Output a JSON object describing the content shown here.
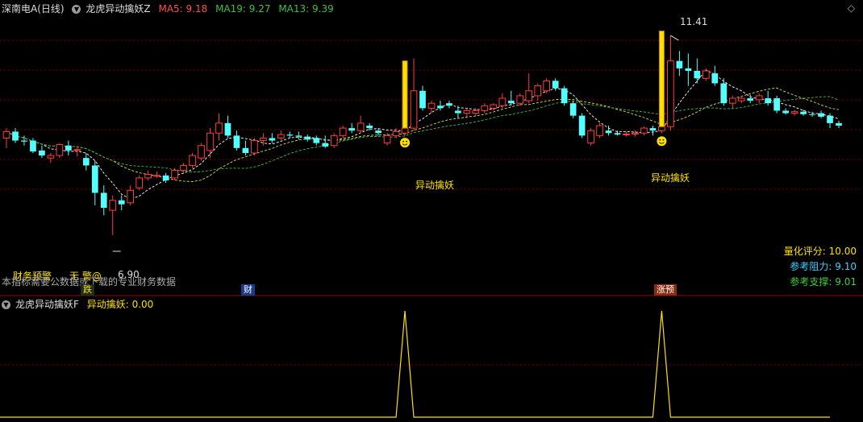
{
  "header": {
    "stock_name": "深南电A(日线)",
    "indicator_name": "龙虎异动擒妖Z",
    "ma5_label": "MA5: 9.18",
    "ma19_label": "MA19: 9.27",
    "ma13_label": "MA13: 9.39"
  },
  "sub_header": {
    "indicator_name": "龙虎异动擒妖F",
    "value_label": "异动擒妖: 0.00"
  },
  "annotations": {
    "high_label": "11.41",
    "low_label": "6.90",
    "signal_label": "异动擒妖",
    "finance_warning": "财务预警",
    "finance_note": "本指标需要公数据或下载的专业财务数据",
    "no_warning": "无 警@",
    "marker_die": "跌",
    "marker_cai": "财",
    "marker_zhang": "涨预"
  },
  "stats": {
    "score_label": "量化评分: 10.00",
    "resist_label": "参考阻力: 9.10",
    "support_label": "参考支撑: 9.01"
  },
  "colors": {
    "up": "#ff3c3c",
    "down": "#54ffff",
    "ma5": "#ffffff",
    "ma13": "#e0e040",
    "ma19": "#40c040",
    "signal": "#ffe000",
    "grid": "#7a0000"
  },
  "chart_data": {
    "type": "candlestick",
    "ylim": [
      6.3,
      11.8
    ],
    "candles": [
      [
        9.35,
        9.55,
        9.15,
        9.48
      ],
      [
        9.48,
        9.55,
        9.25,
        9.3
      ],
      [
        9.3,
        9.4,
        9.2,
        9.28
      ],
      [
        9.3,
        9.35,
        9.05,
        9.08
      ],
      [
        9.1,
        9.2,
        8.95,
        9.0
      ],
      [
        8.95,
        9.05,
        8.85,
        9.0
      ],
      [
        9.0,
        9.25,
        8.95,
        9.22
      ],
      [
        9.2,
        9.3,
        9.0,
        9.1
      ],
      [
        9.1,
        9.18,
        8.98,
        9.12
      ],
      [
        8.95,
        9.05,
        8.7,
        8.8
      ],
      [
        8.8,
        8.9,
        8.0,
        8.25
      ],
      [
        8.25,
        8.4,
        7.8,
        7.95
      ],
      [
        7.9,
        8.2,
        7.4,
        8.1
      ],
      [
        8.1,
        8.2,
        7.9,
        8.02
      ],
      [
        8.05,
        8.4,
        8.0,
        8.3
      ],
      [
        8.35,
        8.6,
        8.3,
        8.55
      ],
      [
        8.55,
        8.7,
        8.5,
        8.62
      ],
      [
        8.6,
        8.68,
        8.55,
        8.6
      ],
      [
        8.6,
        8.65,
        8.45,
        8.5
      ],
      [
        8.55,
        8.75,
        8.5,
        8.7
      ],
      [
        8.7,
        8.85,
        8.65,
        8.8
      ],
      [
        8.8,
        9.05,
        8.75,
        9.0
      ],
      [
        8.95,
        9.25,
        8.9,
        9.2
      ],
      [
        9.1,
        9.55,
        8.95,
        9.45
      ],
      [
        9.45,
        9.85,
        9.3,
        9.65
      ],
      [
        9.65,
        9.8,
        9.35,
        9.4
      ],
      [
        9.4,
        9.5,
        9.1,
        9.15
      ],
      [
        9.15,
        9.3,
        9.0,
        9.05
      ],
      [
        9.05,
        9.35,
        9.0,
        9.3
      ],
      [
        9.3,
        9.45,
        9.2,
        9.35
      ],
      [
        9.35,
        9.45,
        9.25,
        9.3
      ],
      [
        9.35,
        9.5,
        9.3,
        9.42
      ],
      [
        9.42,
        9.48,
        9.35,
        9.4
      ],
      [
        9.4,
        9.48,
        9.32,
        9.38
      ],
      [
        9.38,
        9.42,
        9.28,
        9.32
      ],
      [
        9.35,
        9.4,
        9.2,
        9.25
      ],
      [
        9.25,
        9.4,
        9.15,
        9.18
      ],
      [
        9.2,
        9.45,
        9.15,
        9.4
      ],
      [
        9.4,
        9.6,
        9.35,
        9.55
      ],
      [
        9.55,
        9.65,
        9.45,
        9.5
      ],
      [
        9.5,
        9.8,
        9.45,
        9.65
      ],
      [
        9.6,
        9.65,
        9.5,
        9.55
      ],
      [
        9.5,
        9.55,
        9.4,
        9.45
      ],
      [
        9.25,
        9.45,
        9.2,
        9.4
      ],
      [
        9.4,
        9.55,
        9.35,
        9.48
      ],
      [
        9.45,
        9.6,
        9.4,
        9.55
      ],
      [
        9.55,
        10.95,
        9.5,
        10.3
      ],
      [
        10.3,
        10.4,
        9.9,
        9.95
      ],
      [
        9.95,
        10.1,
        9.85,
        10.05
      ],
      [
        10.0,
        10.1,
        9.9,
        9.95
      ],
      [
        10.05,
        10.1,
        9.95,
        10.0
      ],
      [
        9.9,
        10.0,
        9.75,
        9.85
      ],
      [
        9.85,
        9.95,
        9.75,
        9.9
      ],
      [
        9.85,
        9.95,
        9.8,
        9.9
      ],
      [
        9.9,
        10.05,
        9.85,
        10.0
      ],
      [
        9.95,
        10.05,
        9.9,
        10.02
      ],
      [
        10.0,
        10.25,
        9.95,
        10.15
      ],
      [
        10.1,
        10.3,
        10.0,
        10.05
      ],
      [
        10.05,
        10.25,
        10.0,
        10.2
      ],
      [
        10.1,
        10.65,
        10.05,
        10.3
      ],
      [
        10.2,
        10.45,
        10.1,
        10.4
      ],
      [
        10.3,
        10.55,
        10.25,
        10.5
      ],
      [
        10.5,
        10.55,
        10.3,
        10.35
      ],
      [
        10.35,
        10.4,
        10.0,
        10.05
      ],
      [
        10.05,
        10.1,
        9.75,
        9.8
      ],
      [
        9.8,
        9.85,
        9.35,
        9.4
      ],
      [
        9.25,
        9.55,
        9.2,
        9.5
      ],
      [
        9.4,
        9.65,
        9.35,
        9.6
      ],
      [
        9.5,
        9.6,
        9.4,
        9.45
      ],
      [
        9.45,
        9.5,
        9.4,
        9.42
      ],
      [
        9.42,
        9.48,
        9.38,
        9.43
      ],
      [
        9.43,
        9.5,
        9.38,
        9.45
      ],
      [
        9.45,
        9.58,
        9.4,
        9.55
      ],
      [
        9.55,
        9.6,
        9.4,
        9.5
      ],
      [
        9.5,
        9.62,
        9.45,
        9.58
      ],
      [
        9.58,
        11.41,
        9.5,
        10.9
      ],
      [
        10.9,
        11.1,
        10.6,
        10.75
      ],
      [
        10.75,
        11.05,
        10.4,
        10.7
      ],
      [
        10.7,
        10.95,
        10.45,
        10.55
      ],
      [
        10.55,
        10.75,
        10.5,
        10.7
      ],
      [
        10.65,
        10.8,
        10.4,
        10.45
      ],
      [
        10.45,
        10.55,
        10.0,
        10.05
      ],
      [
        10.05,
        10.2,
        9.95,
        10.15
      ],
      [
        10.1,
        10.2,
        10.05,
        10.15
      ],
      [
        10.15,
        10.22,
        10.05,
        10.1
      ],
      [
        10.12,
        10.25,
        10.05,
        10.2
      ],
      [
        10.15,
        10.3,
        10.0,
        10.05
      ],
      [
        10.15,
        10.2,
        9.85,
        9.9
      ],
      [
        9.9,
        9.95,
        9.82,
        9.85
      ],
      [
        9.85,
        9.92,
        9.8,
        9.88
      ],
      [
        9.88,
        9.92,
        9.8,
        9.83
      ],
      [
        9.83,
        9.88,
        9.78,
        9.82
      ],
      [
        9.85,
        9.9,
        9.75,
        9.78
      ],
      [
        9.8,
        9.85,
        9.55,
        9.65
      ],
      [
        9.65,
        9.7,
        9.55,
        9.6
      ]
    ],
    "signals": [
      46,
      75
    ],
    "high_marker_index": 75,
    "low_marker_index": 12,
    "sub_chart": {
      "type": "line",
      "ylim": [
        0,
        1
      ],
      "values_spike_indices": [
        46,
        75
      ]
    }
  }
}
